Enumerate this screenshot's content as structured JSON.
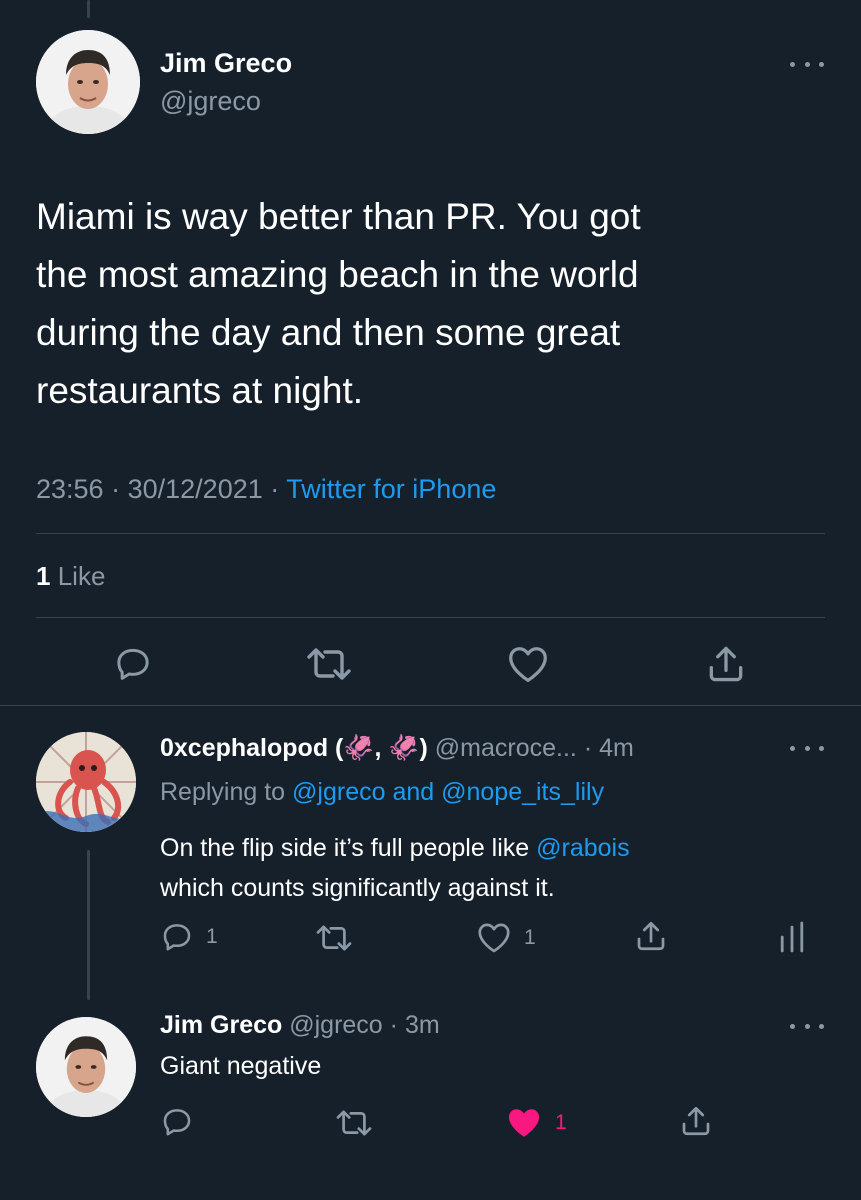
{
  "main_tweet": {
    "author_name": "Jim Greco",
    "author_handle": "@jgreco",
    "text_lines": [
      "Miami is way better than PR. You got",
      "the most amazing beach in the world",
      "during the day and then some great",
      "restaurants at night."
    ],
    "time": "23:56",
    "separator": "·",
    "date": "30/12/2021",
    "source": "Twitter for iPhone",
    "likes_count": "1",
    "likes_label": "Like"
  },
  "reply_1": {
    "author_name": "0xcephalopod (🦑, 🦑)",
    "author_handle": "@macroce...",
    "time": "· 4m",
    "replying_prefix": "Replying to",
    "replying_to": "@jgreco and @nope_its_lily",
    "text_line1_before": "On the flip side it’s full people like ",
    "text_mention": "@rabois",
    "text_line2": "which counts significantly against it.",
    "reply_count": "1",
    "like_count": "1"
  },
  "reply_2": {
    "author_name": "Jim Greco",
    "author_handle": "@jgreco",
    "time": "· 3m",
    "text": "Giant negative",
    "like_count": "1"
  },
  "colors": {
    "background": "#15202b",
    "text": "#ffffff",
    "muted": "#8b98a5",
    "link": "#1d9bf0",
    "like_active": "#f91880",
    "divider": "#38444d"
  },
  "icons": [
    "more-icon",
    "reply-icon",
    "retweet-icon",
    "like-icon",
    "share-icon",
    "analytics-icon"
  ]
}
